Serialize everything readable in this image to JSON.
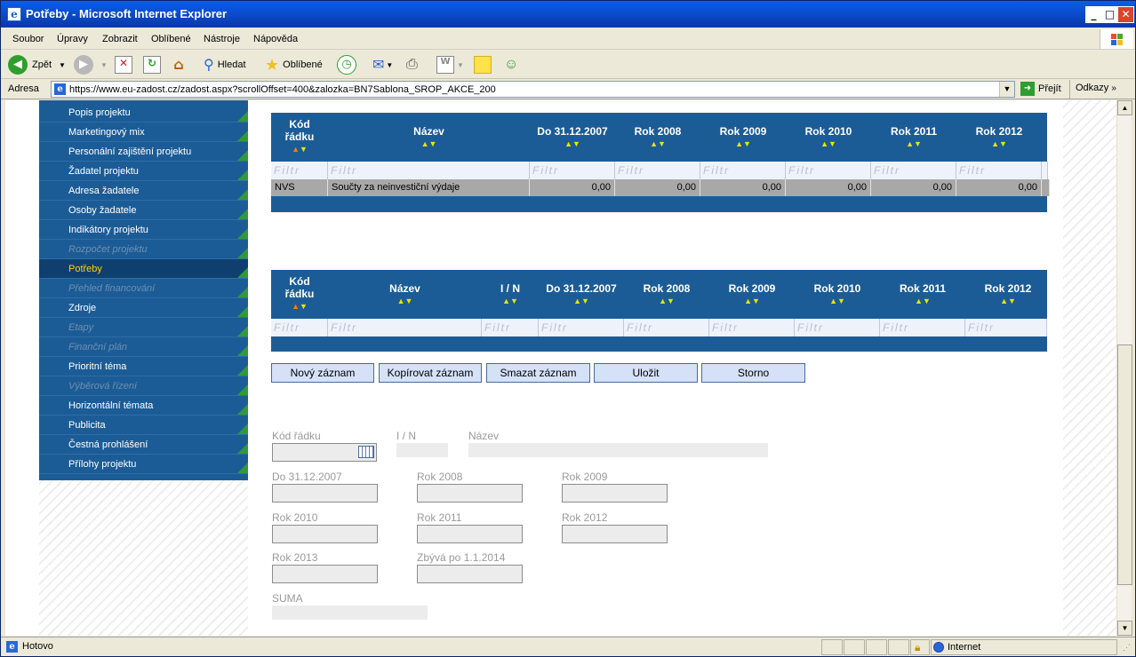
{
  "window": {
    "title": "Potřeby - Microsoft Internet Explorer"
  },
  "menu": [
    "Soubor",
    "Úpravy",
    "Zobrazit",
    "Oblíbené",
    "Nástroje",
    "Nápověda"
  ],
  "toolbar": {
    "back": "Zpět",
    "search": "Hledat",
    "favorites": "Oblíbené"
  },
  "address": {
    "label": "Adresa",
    "url": "https://www.eu-zadost.cz/zadost.aspx?scrollOffset=400&zalozka=BN7Sablona_SROP_AKCE_200",
    "go": "Přejít",
    "links": "Odkazy"
  },
  "sidebar": {
    "items": [
      {
        "label": "Popis projektu",
        "state": "normal"
      },
      {
        "label": "Marketingový mix",
        "state": "normal"
      },
      {
        "label": "Personální zajištění projektu",
        "state": "normal"
      },
      {
        "label": "Žadatel projektu",
        "state": "normal"
      },
      {
        "label": "Adresa žadatele",
        "state": "normal"
      },
      {
        "label": "Osoby žadatele",
        "state": "normal"
      },
      {
        "label": "Indikátory projektu",
        "state": "normal"
      },
      {
        "label": "Rozpočet projektu",
        "state": "disabled"
      },
      {
        "label": "Potřeby",
        "state": "active"
      },
      {
        "label": "Přehled financování",
        "state": "disabled"
      },
      {
        "label": "Zdroje",
        "state": "normal"
      },
      {
        "label": "Etapy",
        "state": "disabled"
      },
      {
        "label": "Finanční plán",
        "state": "disabled"
      },
      {
        "label": "Prioritní téma",
        "state": "normal"
      },
      {
        "label": "Výběrová řízení",
        "state": "disabled"
      },
      {
        "label": "Horizontální témata",
        "state": "normal"
      },
      {
        "label": "Publicita",
        "state": "normal"
      },
      {
        "label": "Čestná prohlášení",
        "state": "normal"
      },
      {
        "label": "Přílohy projektu",
        "state": "normal"
      }
    ]
  },
  "grid1": {
    "columns": [
      "Kód řádku",
      "Název",
      "Do 31.12.2007",
      "Rok 2008",
      "Rok 2009",
      "Rok 2010",
      "Rok 2011",
      "Rok 2012"
    ],
    "filter_placeholder": "Filtr",
    "row": [
      "NVS",
      "Součty za neinvestiční výdaje",
      "0,00",
      "0,00",
      "0,00",
      "0,00",
      "0,00",
      "0,00"
    ]
  },
  "grid2": {
    "columns": [
      "Kód řádku",
      "Název",
      "I / N",
      "Do 31.12.2007",
      "Rok 2008",
      "Rok 2009",
      "Rok 2010",
      "Rok 2011",
      "Rok 2012"
    ],
    "filter_placeholder": "Filtr"
  },
  "buttons": {
    "new": "Nový záznam",
    "copy": "Kopírovat záznam",
    "delete": "Smazat záznam",
    "save": "Uložit",
    "cancel": "Storno"
  },
  "form": {
    "kod": "Kód řádku",
    "in": "I / N",
    "nazev": "Název",
    "do2007": "Do 31.12.2007",
    "r2008": "Rok 2008",
    "r2009": "Rok 2009",
    "r2010": "Rok 2010",
    "r2011": "Rok 2011",
    "r2012": "Rok 2012",
    "r2013": "Rok 2013",
    "zbyva": "Zbývá po 1.1.2014",
    "suma": "SUMA"
  },
  "status": {
    "text": "Hotovo",
    "zone": "Internet"
  }
}
